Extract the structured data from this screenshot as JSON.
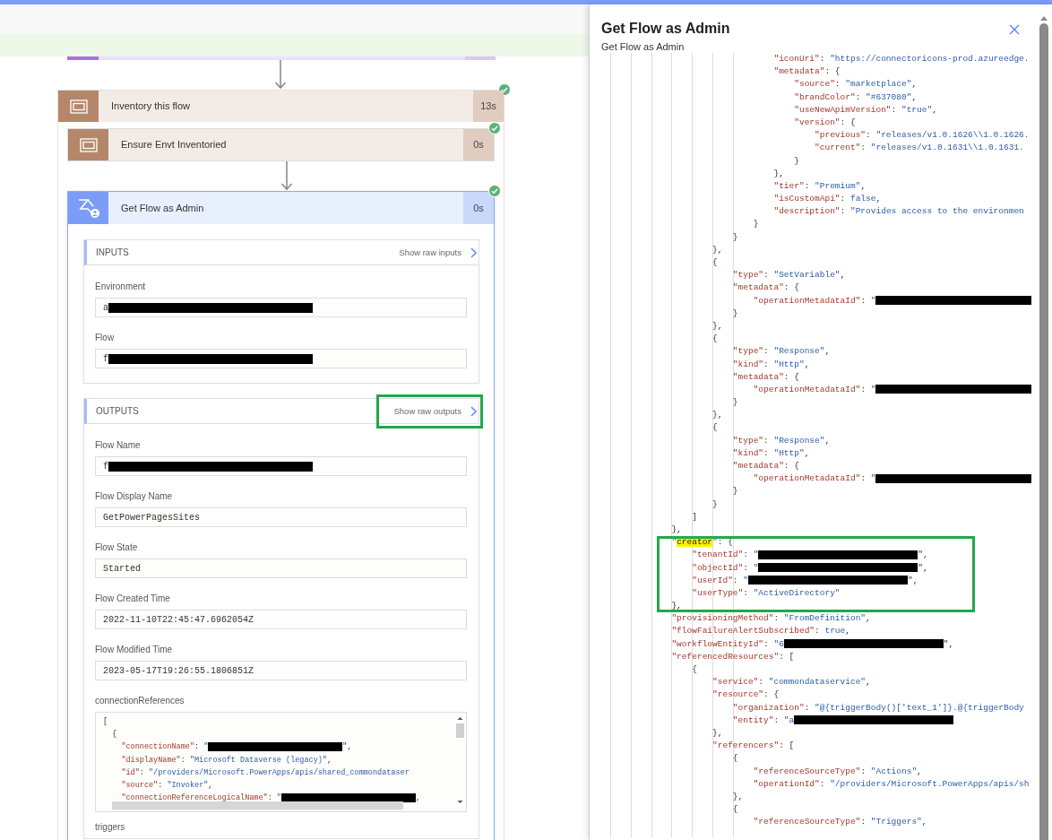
{
  "flow": {
    "scope": {
      "title": "Inventory this flow",
      "duration": "13s",
      "succeeded": true
    },
    "steps": [
      {
        "kind": "scope",
        "title": "Ensure Envt Inventoried",
        "duration": "0s",
        "succeeded": true,
        "expanded": false
      },
      {
        "kind": "admin",
        "title": "Get Flow as Admin",
        "duration": "0s",
        "succeeded": true,
        "expanded": true
      }
    ]
  },
  "inputs": {
    "heading": "INPUTS",
    "raw_link": "Show raw inputs",
    "highlighted": false,
    "fields": [
      {
        "kind": "redacted",
        "label": "Environment",
        "value": "a"
      },
      {
        "kind": "redacted",
        "label": "Flow",
        "value": "f"
      }
    ]
  },
  "outputs": {
    "heading": "OUTPUTS",
    "raw_link": "Show raw outputs",
    "highlighted": true,
    "fields": [
      {
        "kind": "redacted",
        "label": "Flow Name",
        "value": "f"
      },
      {
        "kind": "text",
        "label": "Flow Display Name",
        "value": "GetPowerPagesSites"
      },
      {
        "kind": "text",
        "label": "Flow State",
        "value": "Started"
      },
      {
        "kind": "text",
        "label": "Flow Created Time",
        "value": "2022-11-10T22:45:47.6962054Z"
      },
      {
        "kind": "text",
        "label": "Flow Modified Time",
        "value": "2023-05-17T19:26:55.1806851Z"
      },
      {
        "kind": "code",
        "label": "connectionReferences",
        "lines": [
          {
            "kind": "code",
            "text": "["
          },
          {
            "kind": "code",
            "text": "  {"
          },
          {
            "kind": "redacted",
            "text": "    \"connectionName\": \"",
            "after": "\","
          },
          {
            "kind": "code",
            "text": "    \"displayName\": \"Microsoft Dataverse (legacy)\","
          },
          {
            "kind": "code",
            "text": "    \"id\": \"/providers/Microsoft.PowerApps/apis/shared_commondataser"
          },
          {
            "kind": "code",
            "text": "    \"source\": \"Invoker\","
          },
          {
            "kind": "redacted",
            "text": "    \"connectionReferenceLogicalName\": \"",
            "after": ","
          }
        ]
      },
      {
        "kind": "label",
        "label": "triggers"
      }
    ]
  },
  "panel": {
    "title": "Get Flow as Admin",
    "subtitle": "Get Flow as Admin",
    "code_blocks": [
      {
        "highlighted": false,
        "lines": [
          {
            "kind": "code",
            "text": "                                \"iconUri\": \"https://connectoricons-prod.azureedge."
          },
          {
            "kind": "code",
            "text": "                                \"metadata\": {"
          },
          {
            "kind": "code",
            "text": "                                    \"source\": \"marketplace\","
          },
          {
            "kind": "code",
            "text": "                                    \"brandColor\": \"#637080\","
          },
          {
            "kind": "code",
            "text": "                                    \"useNewApimVersion\": \"true\","
          },
          {
            "kind": "code",
            "text": "                                    \"version\": {"
          },
          {
            "kind": "code",
            "text": "                                        \"previous\": \"releases/v1.0.1626\\\\1.0.1626."
          },
          {
            "kind": "code",
            "text": "                                        \"current\": \"releases/v1.0.1631\\\\1.0.1631."
          },
          {
            "kind": "code",
            "text": "                                    }"
          },
          {
            "kind": "code",
            "text": "                                },"
          },
          {
            "kind": "code",
            "text": "                                \"tier\": \"Premium\","
          },
          {
            "kind": "code",
            "text": "                                \"isCustomApi\": false,"
          },
          {
            "kind": "code",
            "text": "                                \"description\": \"Provides access to the environmen"
          },
          {
            "kind": "code",
            "text": "                            }"
          },
          {
            "kind": "code",
            "text": "                        }"
          },
          {
            "kind": "code",
            "text": "                    },"
          },
          {
            "kind": "code",
            "text": "                    {"
          },
          {
            "kind": "code",
            "text": "                        \"type\": \"SetVariable\","
          },
          {
            "kind": "code",
            "text": "                        \"metadata\": {"
          },
          {
            "kind": "redacted",
            "text": "                            \"operationMetadataId\": \""
          },
          {
            "kind": "code",
            "text": "                        }"
          },
          {
            "kind": "code",
            "text": "                    },"
          },
          {
            "kind": "code",
            "text": "                    {"
          },
          {
            "kind": "code",
            "text": "                        \"type\": \"Response\","
          },
          {
            "kind": "code",
            "text": "                        \"kind\": \"Http\","
          },
          {
            "kind": "code",
            "text": "                        \"metadata\": {"
          },
          {
            "kind": "redacted",
            "text": "                            \"operationMetadataId\": \""
          },
          {
            "kind": "code",
            "text": "                        }"
          },
          {
            "kind": "code",
            "text": "                    },"
          },
          {
            "kind": "code",
            "text": "                    {"
          },
          {
            "kind": "code",
            "text": "                        \"type\": \"Response\","
          },
          {
            "kind": "code",
            "text": "                        \"kind\": \"Http\","
          },
          {
            "kind": "code",
            "text": "                        \"metadata\": {"
          },
          {
            "kind": "redacted",
            "text": "                            \"operationMetadataId\": \""
          },
          {
            "kind": "code",
            "text": "                        }"
          },
          {
            "kind": "code",
            "text": "                    }"
          },
          {
            "kind": "code",
            "text": "                ]"
          },
          {
            "kind": "code",
            "text": "            },"
          }
        ]
      },
      {
        "highlighted": true,
        "lines": [
          {
            "kind": "marked",
            "text": "            \"creator\": {"
          },
          {
            "kind": "redacted",
            "text": "                \"tenantId\": \"",
            "after": "\","
          },
          {
            "kind": "redacted",
            "text": "                \"objectId\": \"",
            "after": "\","
          },
          {
            "kind": "redacted",
            "text": "                \"userId\": \"",
            "after": "\","
          },
          {
            "kind": "code",
            "text": "                \"userType\": \"ActiveDirectory\""
          },
          {
            "kind": "code",
            "text": "            },"
          }
        ]
      },
      {
        "highlighted": false,
        "lines": [
          {
            "kind": "code",
            "text": "            \"provisioningMethod\": \"FromDefinition\","
          },
          {
            "kind": "code",
            "text": "            \"flowFailureAlertSubscribed\": true,"
          },
          {
            "kind": "redacted",
            "text": "            \"workflowEntityId\": \"6",
            "after": "\","
          },
          {
            "kind": "code",
            "text": "            \"referencedResources\": ["
          },
          {
            "kind": "code",
            "text": "                {"
          },
          {
            "kind": "code",
            "text": "                    \"service\": \"commondataservice\","
          },
          {
            "kind": "code",
            "text": "                    \"resource\": {"
          },
          {
            "kind": "code",
            "text": "                        \"organization\": \"@{triggerBody()['text_1']}.@{triggerBody"
          },
          {
            "kind": "redacted",
            "text": "                        \"entity\": \"a"
          },
          {
            "kind": "code",
            "text": "                    },"
          },
          {
            "kind": "code",
            "text": "                    \"referencers\": ["
          },
          {
            "kind": "code",
            "text": "                        {"
          },
          {
            "kind": "code",
            "text": "                            \"referenceSourceType\": \"Actions\","
          },
          {
            "kind": "code",
            "text": "                            \"operationId\": \"/providers/Microsoft.PowerApps/apis/sh"
          },
          {
            "kind": "code",
            "text": "                        },"
          },
          {
            "kind": "code",
            "text": "                        {"
          },
          {
            "kind": "code",
            "text": "                            \"referenceSourceType\": \"Triggers\","
          }
        ]
      }
    ]
  }
}
